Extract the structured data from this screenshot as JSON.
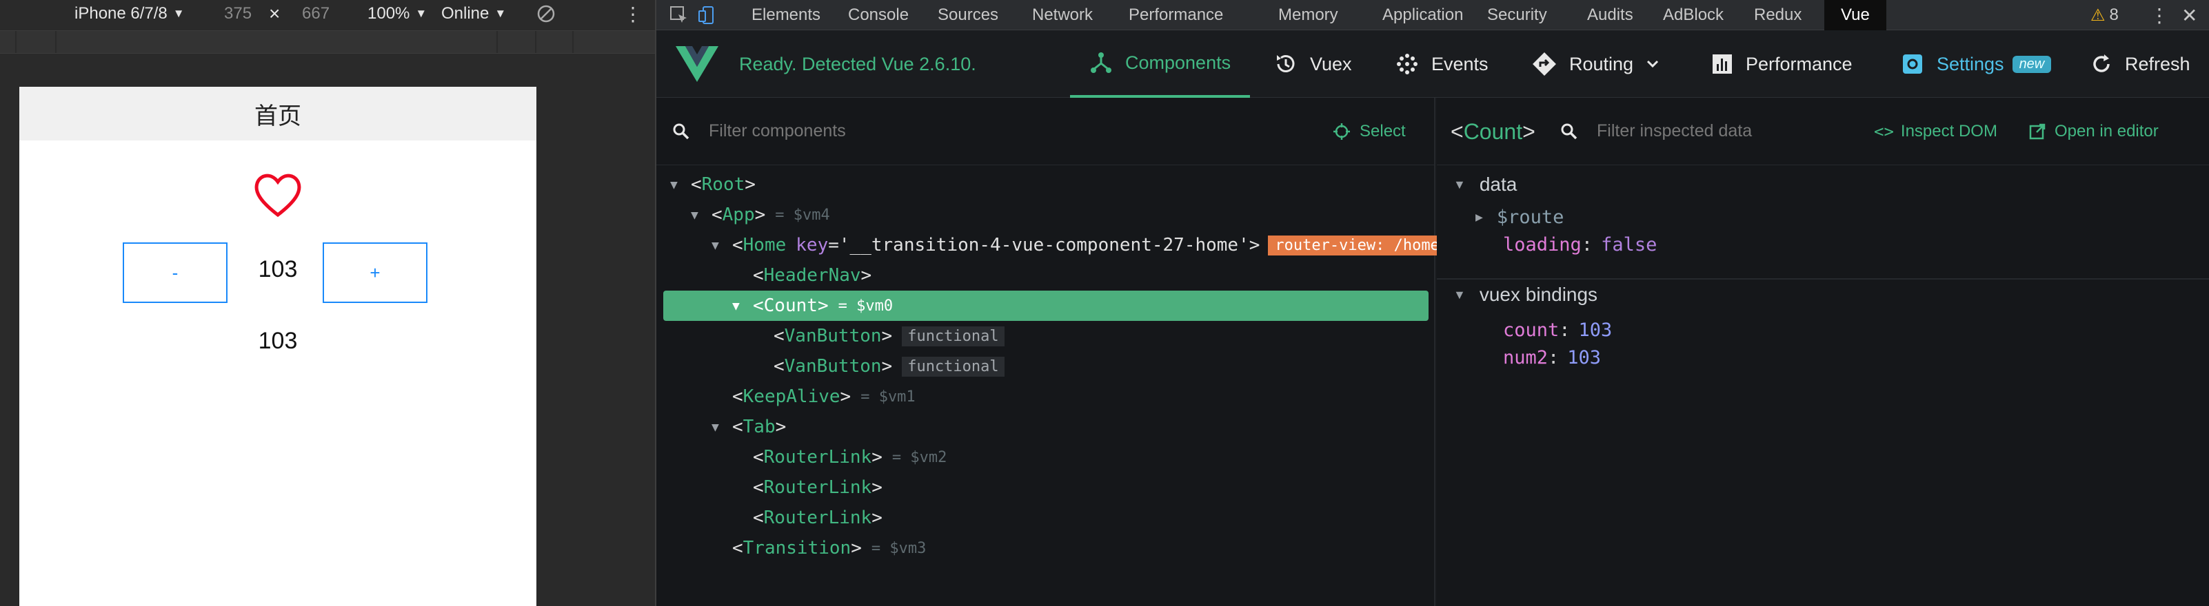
{
  "device_toolbar": {
    "device": "iPhone 6/7/8",
    "width": "375",
    "times": "×",
    "height": "667",
    "zoom": "100%",
    "network": "Online"
  },
  "phone": {
    "header_title": "首页",
    "minus_label": "-",
    "count_value": "103",
    "plus_label": "+",
    "num2_value": "103"
  },
  "devtools_tabs": [
    "Elements",
    "Console",
    "Sources",
    "Network",
    "Performance",
    "Memory",
    "Application",
    "Security",
    "Audits",
    "AdBlock",
    "Redux",
    "Vue"
  ],
  "warning_count": "8",
  "vue_header": {
    "status": "Ready. Detected Vue 2.6.10.",
    "components": "Components",
    "vuex": "Vuex",
    "events": "Events",
    "routing": "Routing",
    "performance": "Performance",
    "settings": "Settings",
    "settings_badge": "new",
    "refresh": "Refresh"
  },
  "components_panel": {
    "filter_placeholder": "Filter components",
    "select_label": "Select",
    "tree": {
      "root": "Root",
      "app": "App",
      "app_ref": "= $vm4",
      "home": "Home",
      "home_key_attr": "key",
      "home_key_value": "'__transition-4-vue-component-27-home'",
      "home_badge": "router-view: /home",
      "headernav": "HeaderNav",
      "count": "Count",
      "count_ref": "= $vm0",
      "vanbutton1": "VanButton",
      "vanbutton2": "VanButton",
      "functional_badge": "functional",
      "keepalive": "KeepAlive",
      "keepalive_ref": "= $vm1",
      "tab": "Tab",
      "routerlink1": "RouterLink",
      "routerlink1_ref": "= $vm2",
      "routerlink2": "RouterLink",
      "routerlink3": "RouterLink",
      "transition": "Transition",
      "transition_ref": "= $vm3"
    }
  },
  "inspector": {
    "component": "Count",
    "filter_placeholder": "Filter inspected data",
    "inspect_dom": "Inspect DOM",
    "open_in_editor": "Open in editor",
    "data_section": "data",
    "route_key": "$route",
    "loading_key": "loading",
    "loading_value": "false",
    "vuex_section": "vuex bindings",
    "count_key": "count",
    "count_value": "103",
    "num2_key": "num2",
    "num2_value": "103"
  }
}
